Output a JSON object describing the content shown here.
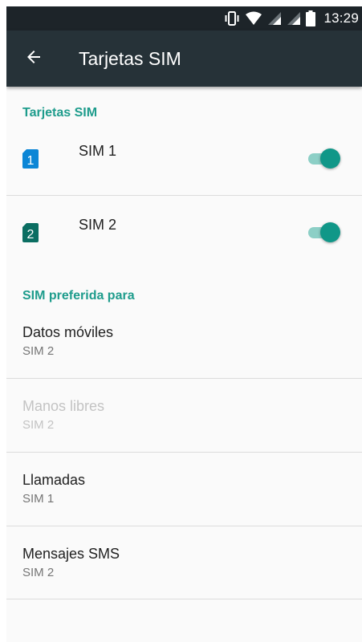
{
  "status_bar": {
    "time": "13:29",
    "icons": [
      "vibrate-icon",
      "wifi-icon",
      "signal-icon",
      "signal-icon",
      "battery-icon"
    ]
  },
  "toolbar": {
    "title": "Tarjetas SIM",
    "back_icon": "arrow-back-icon"
  },
  "sims_section": {
    "header": "Tarjetas SIM",
    "items": [
      {
        "label": "SIM 1",
        "slot_number": "1",
        "icon_color": "#0b86d6",
        "enabled": true
      },
      {
        "label": "SIM 2",
        "slot_number": "2",
        "icon_color": "#0b6e62",
        "enabled": true
      }
    ]
  },
  "preferred_section": {
    "header": "SIM preferida para",
    "items": [
      {
        "title": "Datos móviles",
        "value": "SIM 2",
        "disabled": false
      },
      {
        "title": "Manos libres",
        "value": "SIM 2",
        "disabled": true
      },
      {
        "title": "Llamadas",
        "value": "SIM 1",
        "disabled": false
      },
      {
        "title": "Mensajes SMS",
        "value": "SIM 2",
        "disabled": false
      }
    ]
  },
  "colors": {
    "accent": "#1e9c8c",
    "toolbar": "#263238",
    "status_bar": "#1d2429",
    "switch_thumb": "#109788",
    "switch_track": "#8ccfc6"
  }
}
